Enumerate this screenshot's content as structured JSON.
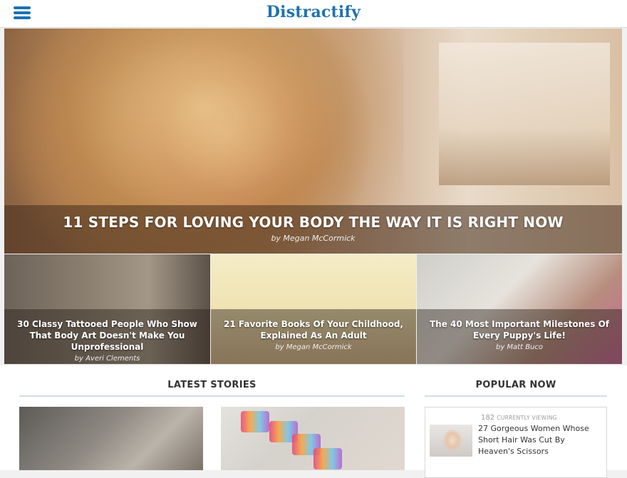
{
  "header": {
    "logo": "Distractify",
    "menu_icon": "hamburger-menu-icon",
    "accent": "#1e73ad"
  },
  "hero": {
    "title": "11 STEPS FOR LOVING YOUR BODY THE WAY IT IS RIGHT NOW",
    "author": "by Megan McCormick"
  },
  "tiles": [
    {
      "title": "30 Classy Tattooed People Who Show That Body Art Doesn't Make You Unprofessional",
      "author": "by Averi Clements"
    },
    {
      "title": "21 Favorite Books Of Your Childhood, Explained As An Adult",
      "author": "by Megan McCormick"
    },
    {
      "title": "The 40 Most Important Milestones Of Every Puppy's Life!",
      "author": "by Matt Buco"
    }
  ],
  "sections": {
    "latest": "LATEST STORIES",
    "popular": "POPULAR NOW"
  },
  "popular": [
    {
      "count": "182",
      "viewing_label": "CURRENTLY VIEWING",
      "title": "27 Gorgeous Women Whose Short Hair Was Cut By Heaven's Scissors"
    }
  ]
}
